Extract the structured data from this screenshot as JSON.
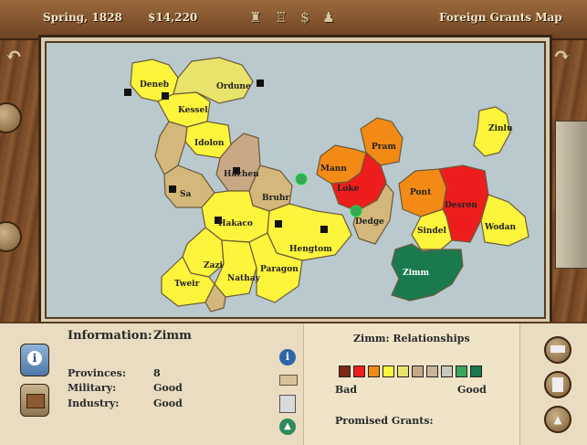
{
  "topbar": {
    "date": "Spring, 1828",
    "money": "$14,220",
    "view_title": "Foreign Grants Map"
  },
  "map": {
    "provinces": [
      {
        "name": "Deneb",
        "color": "#fdf43c"
      },
      {
        "name": "Kessel",
        "color": "#fdf43c"
      },
      {
        "name": "Ordune",
        "color": "#e8e36a"
      },
      {
        "name": "Idolon",
        "color": "#fdf43c"
      },
      {
        "name": "Hachen",
        "color": "#c9a886"
      },
      {
        "name": "Bruhr",
        "color": "#d4b77a"
      },
      {
        "name": "Sa",
        "color": "#d4b77a"
      },
      {
        "name": "Hakaco",
        "color": "#fdf43c"
      },
      {
        "name": "Hengtom",
        "color": "#fdf43c"
      },
      {
        "name": "Zazi",
        "color": "#fdf43c"
      },
      {
        "name": "Nathay",
        "color": "#fdf43c"
      },
      {
        "name": "Paragon",
        "color": "#fdf43c"
      },
      {
        "name": "Tweir",
        "color": "#fdf43c"
      },
      {
        "name": "Pram",
        "color": "#f38a15"
      },
      {
        "name": "Mann",
        "color": "#f38a15"
      },
      {
        "name": "Loke",
        "color": "#ee1d1d"
      },
      {
        "name": "Dedge",
        "color": "#d4b77a"
      },
      {
        "name": "Zinlu",
        "color": "#fdf43c"
      },
      {
        "name": "Pont",
        "color": "#f38a15"
      },
      {
        "name": "Desron",
        "color": "#ee1d1d"
      },
      {
        "name": "Sindel",
        "color": "#fdf43c"
      },
      {
        "name": "Wodan",
        "color": "#fdf43c"
      },
      {
        "name": "Zimm",
        "color": "#1a7a4e"
      }
    ]
  },
  "info": {
    "heading_label": "Information:",
    "heading_value": "Zimm",
    "rows": [
      {
        "label": "Provinces:",
        "value": "8"
      },
      {
        "label": "Military:",
        "value": "Good"
      },
      {
        "label": "Industry:",
        "value": "Good"
      }
    ]
  },
  "relationships": {
    "title": "Zimm: Relationships",
    "scale": [
      "#7a2a12",
      "#ee1d1d",
      "#f38a15",
      "#fdf43c",
      "#e8e36a",
      "#c9a886",
      "#c9b49a",
      "#cbc7bb",
      "#3aa65a",
      "#1a7a4e"
    ],
    "bad_label": "Bad",
    "good_label": "Good",
    "promised_label": "Promised Grants:"
  }
}
